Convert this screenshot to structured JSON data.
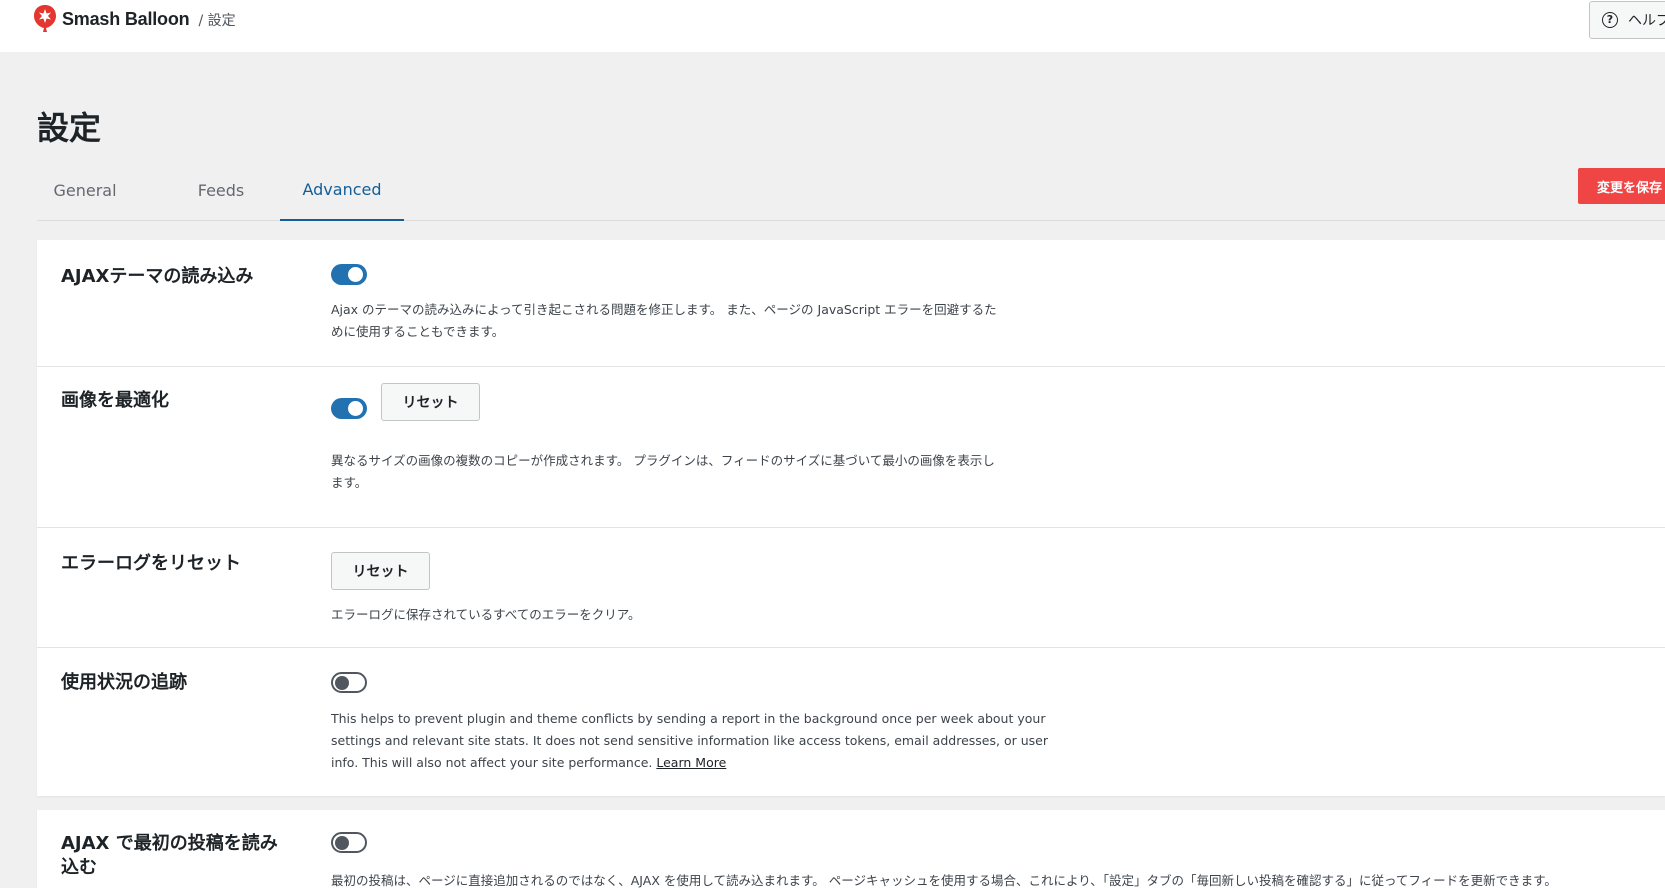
{
  "header": {
    "brand": "Smash Balloon",
    "breadcrumb": "/ 設定",
    "help_label": "ヘルプ"
  },
  "page": {
    "title": "設定",
    "save_label": "変更を保存"
  },
  "tabs": [
    {
      "label": "General",
      "active": false
    },
    {
      "label": "Feeds",
      "active": false
    },
    {
      "label": "Advanced",
      "active": true
    }
  ],
  "settings": [
    {
      "label": "AJAXテーマの読み込み",
      "toggle": true,
      "description_line1": "Ajax のテーマの読み込みによって引き起こされる問題を修正します。 また、ページの JavaScript エラーを回避するた",
      "description_line2": "めに使用することもできます。"
    },
    {
      "label": "画像を最適化",
      "toggle": true,
      "button": "リセット",
      "description_line1": "異なるサイズの画像の複数のコピーが作成されます。 プラグインは、フィードのサイズに基づいて最小の画像を表示し",
      "description_line2": "ます。"
    },
    {
      "label": "エラーログをリセット",
      "button": "リセット",
      "description_line1": "エラーログに保存されているすべてのエラーをクリア。"
    },
    {
      "label": "使用状況の追跡",
      "toggle": false,
      "description_line1": "This helps to prevent plugin and theme conflicts by sending a report in the background once per week about your",
      "description_line2": "settings and relevant site stats. It does not send sensitive information like access tokens, email addresses, or user",
      "description_line3": "info. This will also not affect your site performance.",
      "link": "Learn More"
    },
    {
      "label": "AJAX で最初の投稿を読み込む",
      "toggle": false,
      "description_line1": "最初の投稿は、ページに直接追加されるのではなく、AJAX を使用して読み込まれます。 ページキャッシュを使用する場合、これにより、「設定」タブの「毎回新しい投稿を確認する」に従ってフィードを更新できます。"
    }
  ],
  "colors": {
    "accent_blue": "#2271b1",
    "save_red": "#f04545",
    "brand_red": "#e4362e"
  }
}
